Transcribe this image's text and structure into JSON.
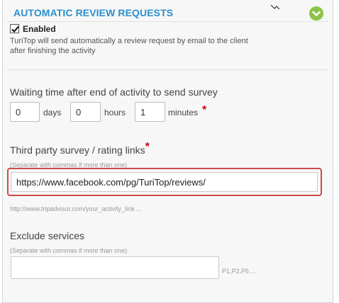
{
  "section": {
    "title": "AUTOMATIC REVIEW REQUESTS",
    "collapse_icon": "chevron-down-icon",
    "accent_color": "#2a8fcf",
    "toggle_color": "#8cc34a"
  },
  "enabled": {
    "checked": true,
    "label": "Enabled",
    "description_line1": "TuriTop will send automatically a review request by email to the client",
    "description_line2": "after finishing the activity"
  },
  "waiting": {
    "label": "Waiting time after end of activity to send survey",
    "required_mark": "*",
    "days_value": "0",
    "days_unit": "days",
    "hours_value": "0",
    "hours_unit": "hours",
    "minutes_value": "1",
    "minutes_unit": "minutes"
  },
  "survey_links": {
    "label": "Third party survey / rating links",
    "required_mark": "*",
    "hint": "(Separate with commas if more than one)",
    "value": "https://www.facebook.com/pg/TuriTop/reviews/",
    "example": "http://www.tripadvisor.com/your_activity_link ..."
  },
  "exclude": {
    "label": "Exclude services",
    "hint": "(Separate with commas if more than one)",
    "value": "",
    "example": "P1,P2,P6 ..."
  }
}
